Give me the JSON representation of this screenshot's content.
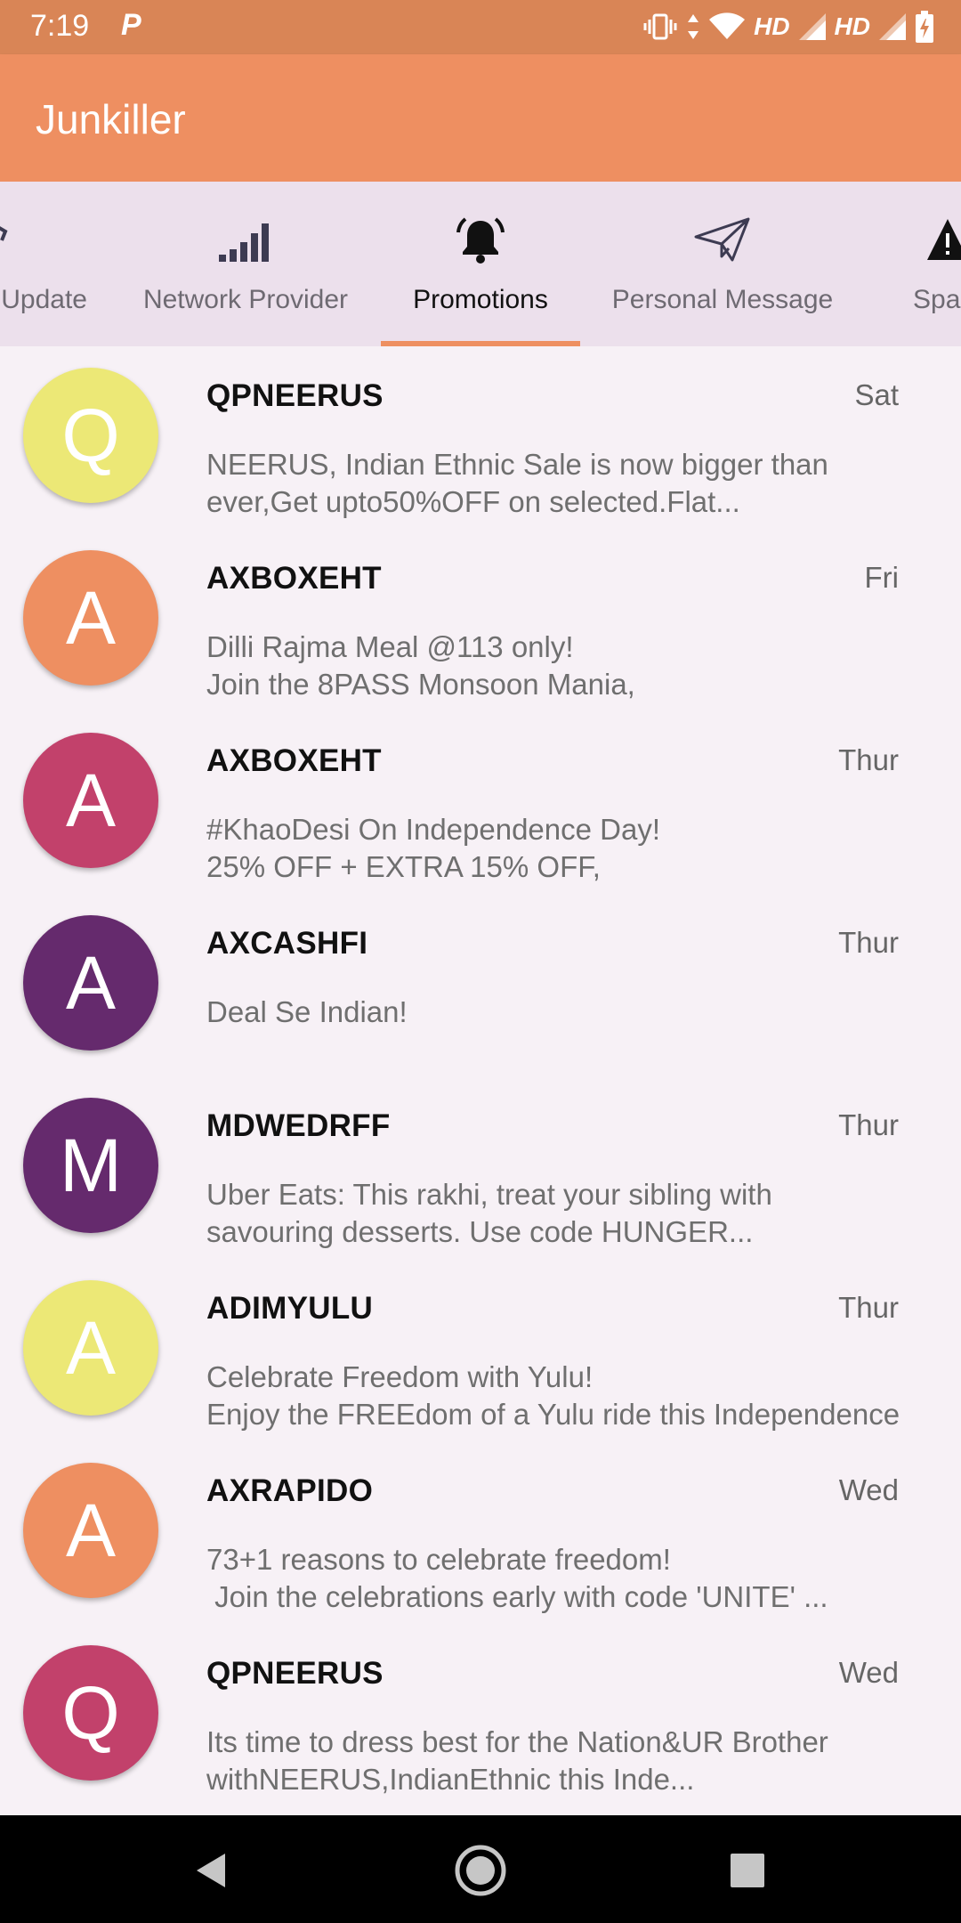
{
  "status_bar": {
    "time": "7:19",
    "app_indicator": "P",
    "network_label_1": "HD",
    "network_label_2": "HD",
    "icons": [
      "vibrate-icon",
      "data-arrows-icon",
      "wifi-icon",
      "signal-icon",
      "signal-icon",
      "battery-charging-icon"
    ]
  },
  "app": {
    "title": "Junkiller",
    "accent_color": "#ee8f61"
  },
  "tabs": [
    {
      "label": "Update",
      "icon": "update-icon",
      "active": false
    },
    {
      "label": "Network Provider",
      "icon": "signal-bars-icon",
      "active": false
    },
    {
      "label": "Promotions",
      "icon": "bell-icon",
      "active": true
    },
    {
      "label": "Personal Message",
      "icon": "paper-plane-icon",
      "active": false
    },
    {
      "label": "Spa",
      "icon": "warning-icon",
      "active": false
    }
  ],
  "messages": [
    {
      "initial": "Q",
      "sender": "QPNEERUS",
      "date": "Sat",
      "preview": "NEERUS, Indian Ethnic Sale is now bigger than\never,Get upto50%OFF on selected.Flat...",
      "color": "#ece876"
    },
    {
      "initial": "A",
      "sender": "AXBOXEHT",
      "date": "Fri",
      "preview": "Dilli Rajma Meal @113 only!\nJoin the 8PASS Monsoon Mania,",
      "color": "#ee8f61"
    },
    {
      "initial": "A",
      "sender": "AXBOXEHT",
      "date": "Thur",
      "preview": "#KhaoDesi On Independence Day!\n25% OFF + EXTRA 15% OFF,",
      "color": "#c2416b"
    },
    {
      "initial": "A",
      "sender": "AXCASHFI",
      "date": "Thur",
      "preview": "Deal Se Indian!",
      "color": "#652a6d"
    },
    {
      "initial": "M",
      "sender": "MDWEDRFF",
      "date": "Thur",
      "preview": "Uber Eats: This rakhi, treat your sibling with\nsavouring desserts. Use code HUNGER...",
      "color": "#652a6d"
    },
    {
      "initial": "A",
      "sender": "ADIMYULU",
      "date": "Thur",
      "preview": "Celebrate Freedom with Yulu!\nEnjoy the FREEdom of a Yulu ride this Independence",
      "color": "#ece876"
    },
    {
      "initial": "A",
      "sender": "AXRAPIDO",
      "date": "Wed",
      "preview": "73+1 reasons to celebrate freedom!\n Join the celebrations early with code 'UNITE' ...",
      "color": "#ee8f61"
    },
    {
      "initial": "Q",
      "sender": "QPNEERUS",
      "date": "Wed",
      "preview": "Its time to dress best for the Nation&UR Brother\nwithNEERUS,IndianEthnic this Inde...",
      "color": "#c2416b"
    }
  ],
  "nav": {
    "buttons": [
      "back-icon",
      "home-icon",
      "recents-icon"
    ]
  }
}
